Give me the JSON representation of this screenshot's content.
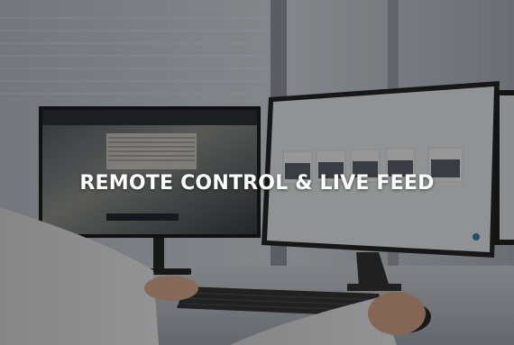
{
  "hero": {
    "title": "REMOTE CONTROL & LIVE FEED"
  },
  "colors": {
    "overlay": "#141416",
    "title_text": "#ffffff"
  },
  "icons": {
    "left_monitor_feed": "camera-feed-image",
    "right_monitor_thumbnails": "camera-thumbnail-grid"
  }
}
